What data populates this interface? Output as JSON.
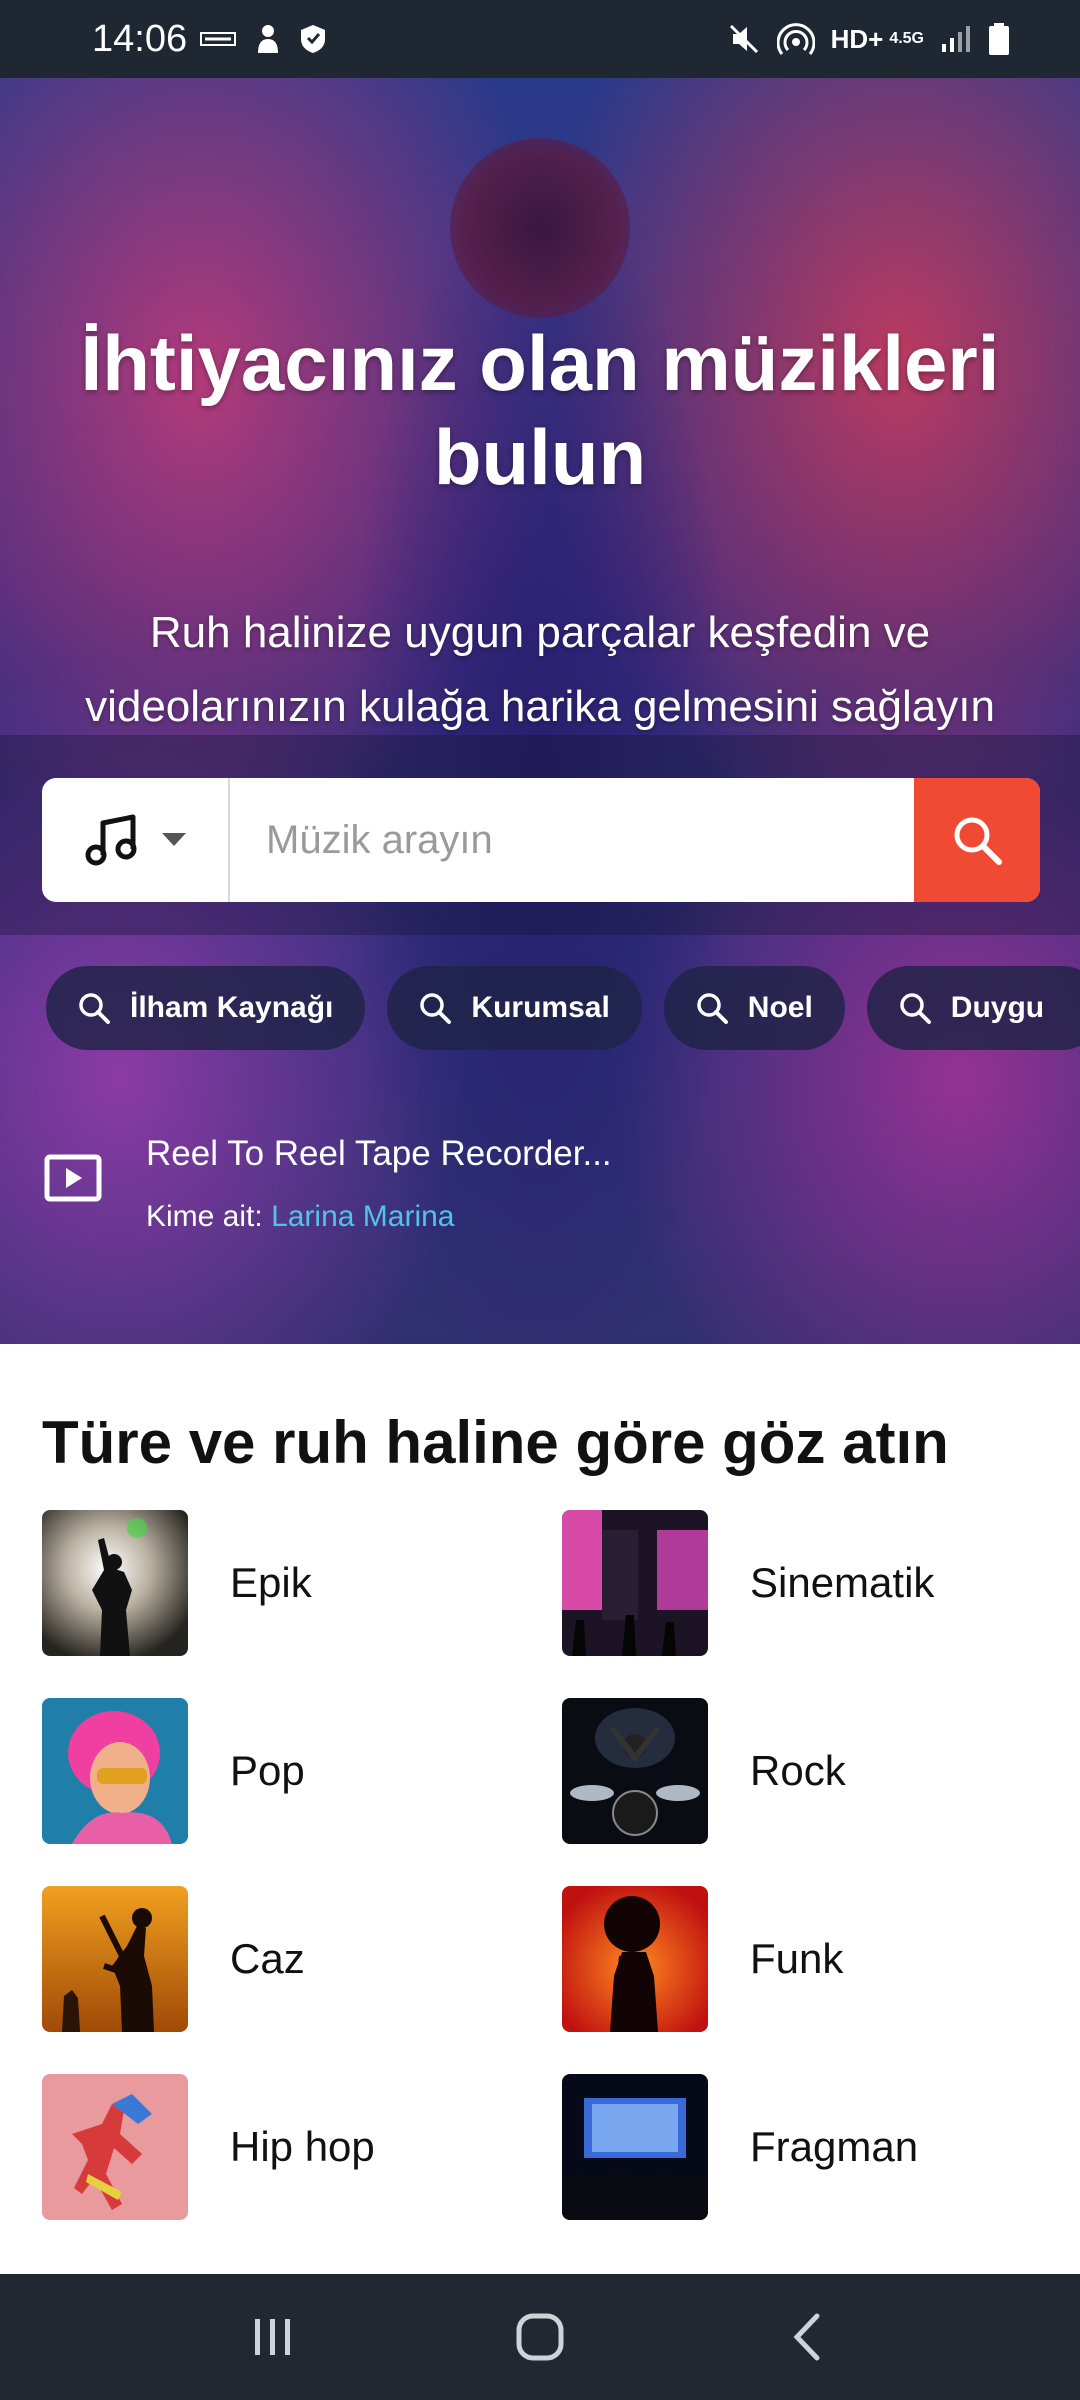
{
  "status_bar": {
    "time": "14:06",
    "network": "HD+",
    "network_type": "4.5G",
    "left_icons": [
      "message-icon",
      "hand-icon",
      "shield-icon"
    ],
    "right_icons": [
      "mute-icon",
      "hotspot-icon",
      "signal-icon",
      "battery-icon"
    ]
  },
  "hero": {
    "title_line1": "İhtiyacınız olan müzikleri",
    "title_line2": "bulun",
    "subtitle_line1": "Ruh halinize uygun parçalar keşfedin ve",
    "subtitle_line2": "videolarınızın kulağa harika gelmesini sağlayın"
  },
  "search": {
    "category_icon": "music-note-icon",
    "placeholder": "Müzik arayın",
    "value": "",
    "button_icon": "search-icon"
  },
  "chips": [
    {
      "label": "İlham Kaynağı"
    },
    {
      "label": "Kurumsal"
    },
    {
      "label": "Noel"
    },
    {
      "label": "Duygu"
    }
  ],
  "now_playing": {
    "title": "Reel To Reel Tape Recorder...",
    "author_prefix": "Kime ait:",
    "author_name": "Larina Marina"
  },
  "genres_section": {
    "title": "Türe ve ruh haline göre göz atın",
    "items": [
      {
        "label": "Epik"
      },
      {
        "label": "Sinematik"
      },
      {
        "label": "Pop"
      },
      {
        "label": "Rock"
      },
      {
        "label": "Caz"
      },
      {
        "label": "Funk"
      },
      {
        "label": "Hip hop"
      },
      {
        "label": "Fragman"
      }
    ]
  },
  "nav_bar": {
    "buttons": [
      "recents-icon",
      "home-icon",
      "back-icon"
    ]
  },
  "colors": {
    "accent": "#f04a34",
    "link": "#4fc3e8",
    "status_bar": "#1f2733",
    "nav_bar": "#222831"
  }
}
